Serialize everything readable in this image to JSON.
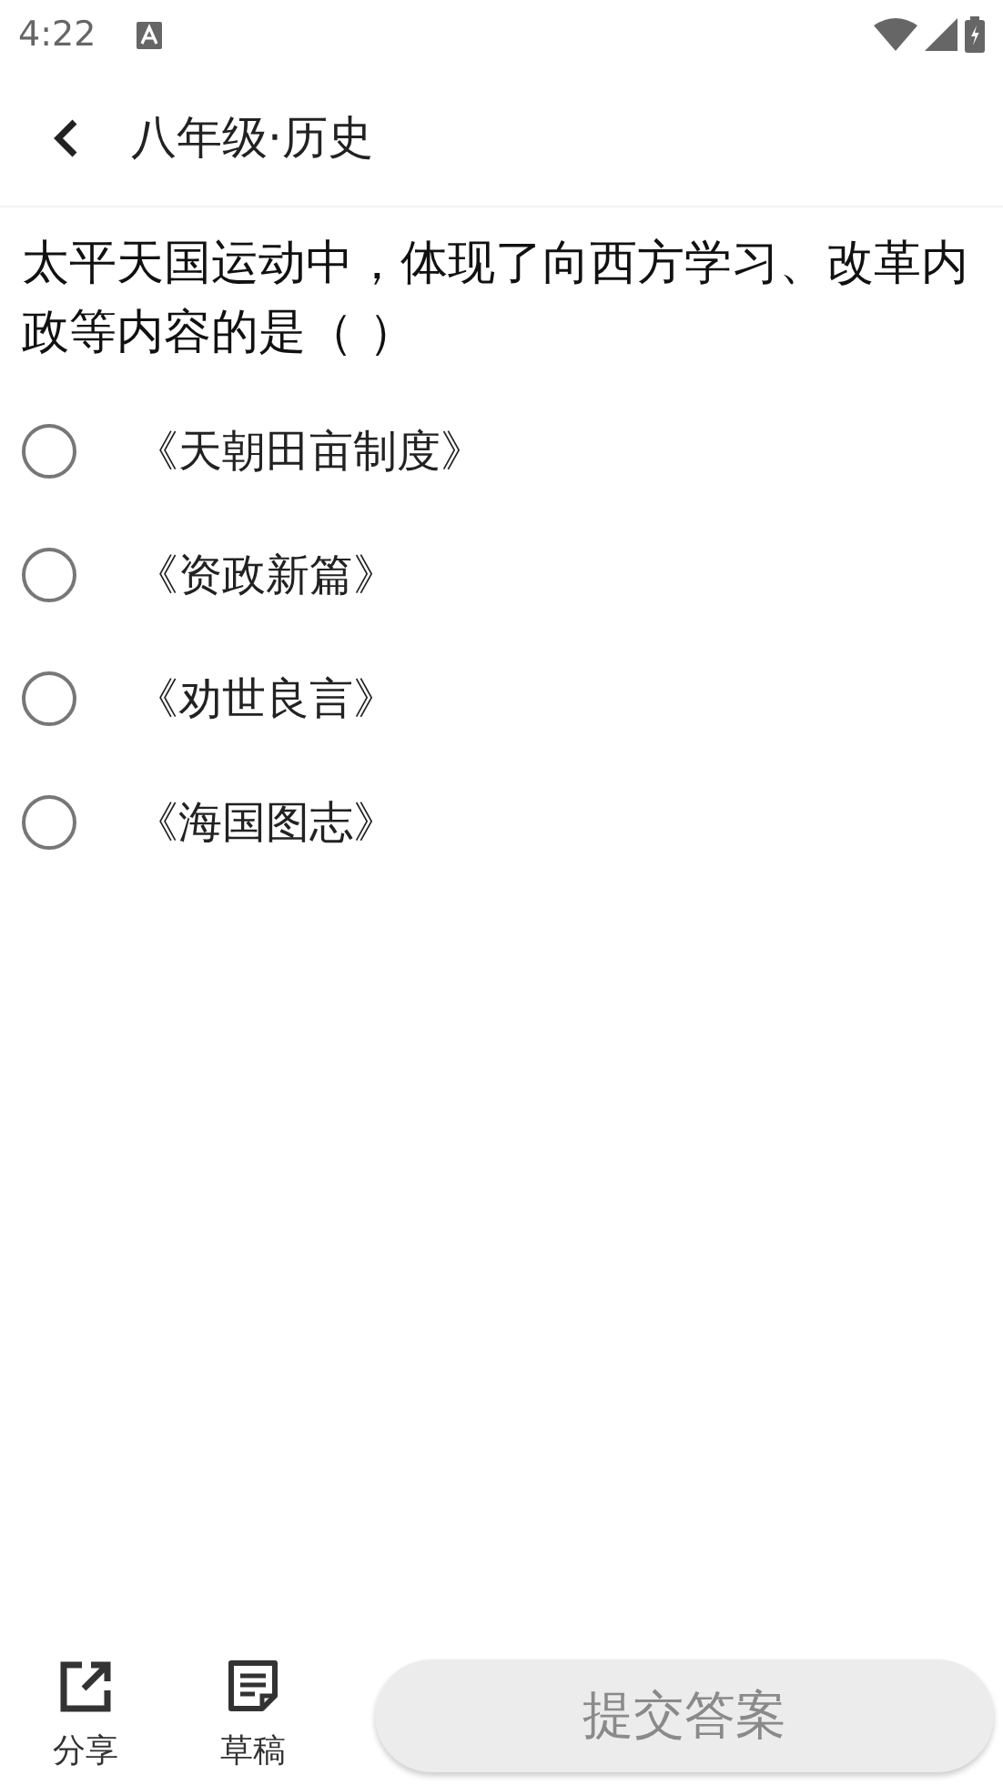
{
  "status_bar": {
    "time": "4:22"
  },
  "header": {
    "title": "八年级·历史"
  },
  "question": {
    "text": "太平天国运动中，体现了向西方学习、改革内政等内容的是（ ）"
  },
  "options": [
    {
      "label": "《天朝田亩制度》",
      "selected": false
    },
    {
      "label": "《资政新篇》",
      "selected": false
    },
    {
      "label": "《劝世良言》",
      "selected": false
    },
    {
      "label": "《海国图志》",
      "selected": false
    }
  ],
  "bottom_bar": {
    "actions": [
      {
        "kind": "share",
        "label": "分享"
      },
      {
        "kind": "draft",
        "label": "草稿"
      }
    ],
    "submit": {
      "label": "提交答案",
      "disabled": true
    }
  }
}
